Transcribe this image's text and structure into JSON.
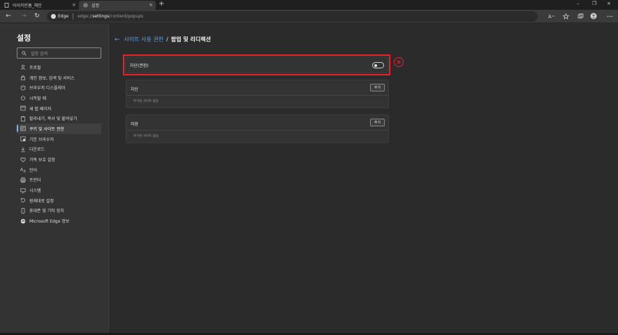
{
  "tabs": [
    {
      "title": "아이카린홈_해인",
      "close": "×"
    },
    {
      "title": "설정",
      "close": "×"
    }
  ],
  "new_tab": "+",
  "window_controls": {
    "minimize": "–",
    "restore": "❐",
    "close": "×"
  },
  "toolbar": {
    "back": "←",
    "forward": "→",
    "refresh": "↻",
    "brand": "Edge",
    "url_pre": "edge://",
    "url_main": "settings",
    "url_post": "/content/popups"
  },
  "sidebar": {
    "title": "설정",
    "search_placeholder": "설정 검색",
    "items": [
      {
        "label": "프로필",
        "icon": "profile-icon"
      },
      {
        "label": "개인 정보, 검색 및 서비스",
        "icon": "lock-icon"
      },
      {
        "label": "브라우저 디스플레이",
        "icon": "palette-icon"
      },
      {
        "label": "시작할 때",
        "icon": "power-icon"
      },
      {
        "label": "새 탭 페이지",
        "icon": "newtab-icon"
      },
      {
        "label": "할라내기, 복사 및 붙여넣기",
        "icon": "clipboard-icon"
      },
      {
        "label": "쿠키 및 사이트 권한",
        "icon": "cookie-icon"
      },
      {
        "label": "기본 브라우저",
        "icon": "browser-icon"
      },
      {
        "label": "다운로드",
        "icon": "download-icon"
      },
      {
        "label": "가족 보호 설정",
        "icon": "family-icon"
      },
      {
        "label": "언어",
        "icon": "language-icon"
      },
      {
        "label": "프린터",
        "icon": "printer-icon"
      },
      {
        "label": "시스템",
        "icon": "system-icon"
      },
      {
        "label": "원래대로 설정",
        "icon": "reset-icon"
      },
      {
        "label": "휴대폰 및 기타 장치",
        "icon": "phone-icon"
      },
      {
        "label": "Microsoft Edge 정보",
        "icon": "edge-icon"
      }
    ],
    "selected_index": 6
  },
  "main": {
    "breadcrumb_back": "←",
    "breadcrumb_link": "사이트 사용 권한",
    "breadcrumb_sep": "/",
    "breadcrumb_current": "팝업 및 리디렉션",
    "toggle": {
      "label": "차단(권장)",
      "on": false
    },
    "annotation_number": "⑤",
    "block": {
      "header": "차단",
      "button": "추가",
      "empty_text": "추가된 사이트 없음"
    },
    "allow": {
      "header": "허용",
      "button": "추가",
      "empty_text": "추가된 사이트 없음"
    }
  },
  "colors": {
    "accent": "#5ea0e8",
    "highlight": "#e8232b",
    "bg": "#2b2b2b",
    "sidebar": "#333333"
  }
}
